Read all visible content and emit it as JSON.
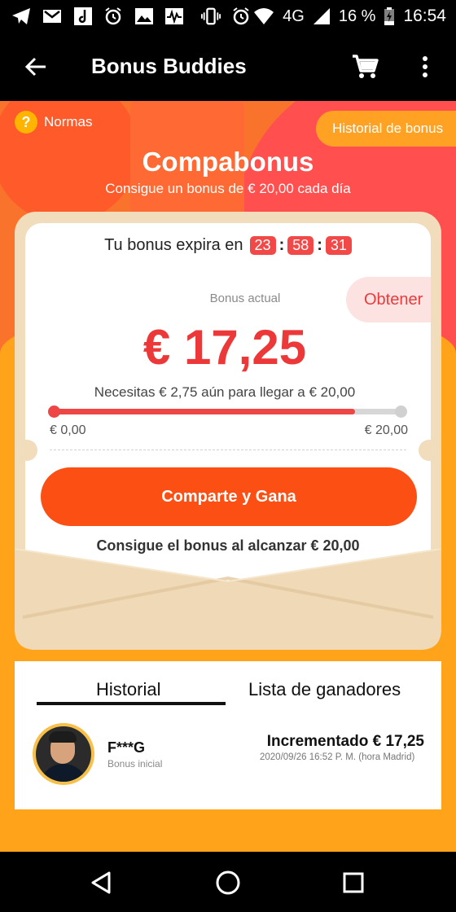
{
  "status_bar": {
    "battery": "16 %",
    "network": "4G",
    "time": "16:54",
    "icons": [
      "telegram-icon",
      "gmail-icon",
      "music-icon",
      "alarm-icon",
      "image-icon",
      "activity-icon",
      "vibrate-icon",
      "alarm-icon",
      "wifi-icon",
      "signal-icon",
      "battery-charging-icon"
    ]
  },
  "app_bar": {
    "title": "Bonus Buddies",
    "back_icon": "arrow-back-icon",
    "cart_icon": "cart-icon",
    "more_icon": "more-vert-icon"
  },
  "hero": {
    "rules_label": "Normas",
    "history_button": "Historial de bonus",
    "title": "Compabonus",
    "subtitle": "Consigue un bonus de € 20,00 cada día"
  },
  "card": {
    "expires_label": "Tu bonus expira en",
    "timer": {
      "hours": "23",
      "minutes": "58",
      "seconds": "31"
    },
    "bonus_label": "Bonus actual",
    "claim_button": "Obtener",
    "amount": "€ 17,25",
    "need_text": "Necesitas € 2,75 aún para llegar a € 20,00",
    "progress_fraction": 0.8625,
    "progress_min": "€ 0,00",
    "progress_max": "€ 20,00",
    "share_button": "Comparte y Gana",
    "reach_text": "Consigue el bonus al alcanzar € 20,00"
  },
  "history": {
    "tabs": [
      {
        "label": "Historial",
        "active": true
      },
      {
        "label": "Lista de ganadores",
        "active": false
      }
    ],
    "entries": [
      {
        "name": "F***G",
        "subtitle": "Bonus inicial",
        "amount_text": "Incrementado € 17,25",
        "date": "2020/09/26 16:52 P. M. (hora Madrid)"
      }
    ]
  },
  "nav_bar": {
    "back": "nav-back-icon",
    "home": "nav-home-icon",
    "recents": "nav-recents-icon"
  },
  "colors": {
    "accent_red": "#ec3838",
    "button_orange": "#fc4f14",
    "background_orange": "#ffa41a"
  }
}
